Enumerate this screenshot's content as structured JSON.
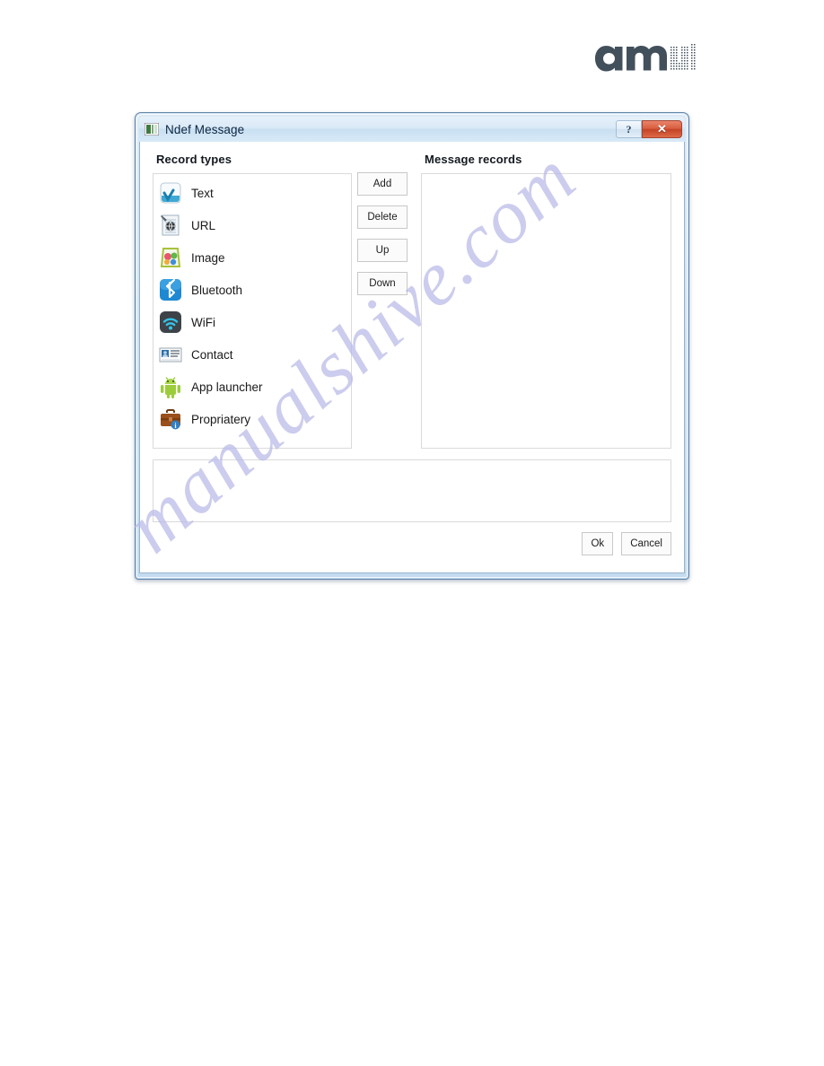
{
  "page": {
    "watermark_text": "manualshive.com",
    "watermark_color": "#b9b9e8",
    "background_color": "#ffffff"
  },
  "brand": {
    "name": "ams",
    "logo_color": "#42505c"
  },
  "dialog": {
    "title": "Ndef Message",
    "app_icon": "ndef-app-icon",
    "titlebar_buttons": [
      {
        "name": "help-button",
        "glyph": "?"
      },
      {
        "name": "close-button",
        "glyph": "✕"
      }
    ],
    "accent_close_color": "#c44327",
    "chrome_color": "#cfe2f3",
    "record_types": {
      "label": "Record types",
      "items": [
        {
          "label": "Text",
          "icon": "text-record-icon"
        },
        {
          "label": "URL",
          "icon": "url-record-icon"
        },
        {
          "label": "Image",
          "icon": "image-record-icon"
        },
        {
          "label": "Bluetooth",
          "icon": "bluetooth-record-icon"
        },
        {
          "label": "WiFi",
          "icon": "wifi-record-icon"
        },
        {
          "label": "Contact",
          "icon": "contact-record-icon"
        },
        {
          "label": "App launcher",
          "icon": "app-launcher-record-icon"
        },
        {
          "label": "Propriatery",
          "icon": "proprietary-record-icon"
        }
      ]
    },
    "action_buttons": [
      {
        "label": "Add",
        "name": "add-button"
      },
      {
        "label": "Delete",
        "name": "delete-button"
      },
      {
        "label": "Up",
        "name": "up-button"
      },
      {
        "label": "Down",
        "name": "down-button"
      }
    ],
    "message_records": {
      "label": "Message records",
      "items": []
    },
    "detail_panel": {
      "content": ""
    },
    "footer_buttons": [
      {
        "label": "Ok",
        "name": "ok-button"
      },
      {
        "label": "Cancel",
        "name": "cancel-button"
      }
    ]
  }
}
